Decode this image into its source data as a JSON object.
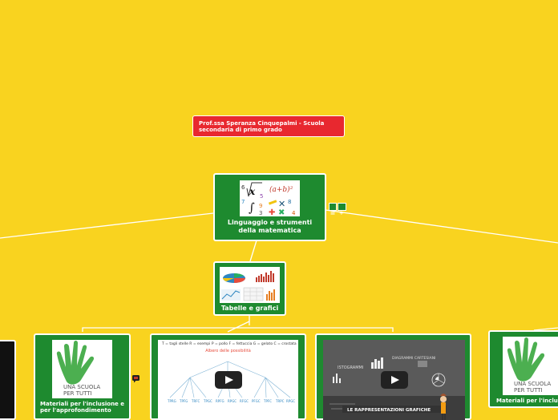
{
  "author_note": "Prof.ssa Speranza Cinquepalmi  - Scuola secondaria di primo grado",
  "central_topic": "Linguaggio e strumenti della matematica",
  "subtopic": "Tabelle e grafici",
  "nodes": {
    "inclusion": "Materiali per l'inclusione e per l'approfondimento",
    "inclusion_right": "Materiali per l'inclusi"
  },
  "logo_text": {
    "line1": "UNA SCUOLA",
    "line2": "PER TUTTI"
  },
  "video_tree": {
    "legend": "T = tagli stelle    R = esempi    P = pollo    F = fettuccia    G = gelato    C = crostata",
    "title": "Albero delle possibilità"
  },
  "video_graphs": {
    "caption": "LE RAPPRESENTAZIONI GRAFICHE",
    "words": [
      "ISTOGRAMMI",
      "DIAGRAMMI CARTESIANI"
    ]
  },
  "math_image": {
    "formula": "(a+b)²",
    "symbol": "x"
  },
  "colors": {
    "background": "#f9d31f",
    "node": "#1e8a2f",
    "author": "#e8282f"
  },
  "icons": [
    "notes-icon",
    "add-icon",
    "play-icon",
    "comment-icon"
  ]
}
